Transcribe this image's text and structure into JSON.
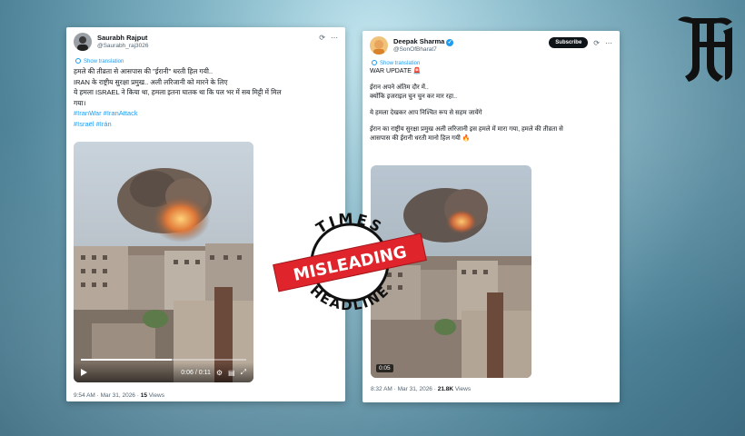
{
  "left_post": {
    "username": "Saurabh Rajput",
    "handle": "@Saurabh_raj3026",
    "show_translation": "Show translation",
    "lines": [
      "हमले की तीव्रता से आसपास की \"ईरानी\" धरती हिल गयी..",
      "IRAN के राष्ट्रीय सुरक्षा प्रमुख.. अली लरिजानी को मारने के लिए",
      "ये हमला ISRAEL ने किया था, हमला इतना घातक था कि पल भर में सब मिट्टी में मिल",
      "गया।"
    ],
    "hashtags_line1": "#IranWar #IranAttack",
    "hashtags_line2": "#Israël #Irán",
    "video_time": "0:06 / 0:11",
    "progress_fraction": 0.55,
    "timestamp": "9:54 AM · Mar 31, 2026 · ",
    "views_count": "15",
    "views_label": " Views"
  },
  "right_post": {
    "username": "Deepak Sharma",
    "handle": "@SonOfBharat7",
    "subscribe_label": "Subscribe",
    "show_translation": "Show translation",
    "line1": "WAR UPDATE 🚨",
    "line2": "ईरान अपने अंतिम दौर में..",
    "line3": "क्योंकि इजराइल चुन चुन कर मार रहा..",
    "line4": "ये हमला देखकर आप निश्चित रूप से सहम जायेंगे",
    "line5": "ईरान का राष्ट्रीय सुरक्षा प्रमुख अली लरिजानी इस हमले में मारा गया, हमले की तीव्रता से",
    "line6": "आसपास की ईरानी धरती मानो हिल गयी 🔥",
    "video_duration": "0:05",
    "timestamp": "8:32 AM · Mar 31, 2026 · ",
    "views_count": "21.8K",
    "views_label": " Views"
  },
  "stamp": {
    "top_text": "TIMES",
    "bottom_text": "HEADLINE",
    "banner_text": "MISLEADING"
  },
  "icons": {
    "more": "more-icon",
    "grok": "grok-icon",
    "verified": "verified-badge-icon"
  },
  "colors": {
    "link": "#1d9bf0",
    "stamp_red": "#e0242b",
    "background": "#7fb3c4"
  }
}
